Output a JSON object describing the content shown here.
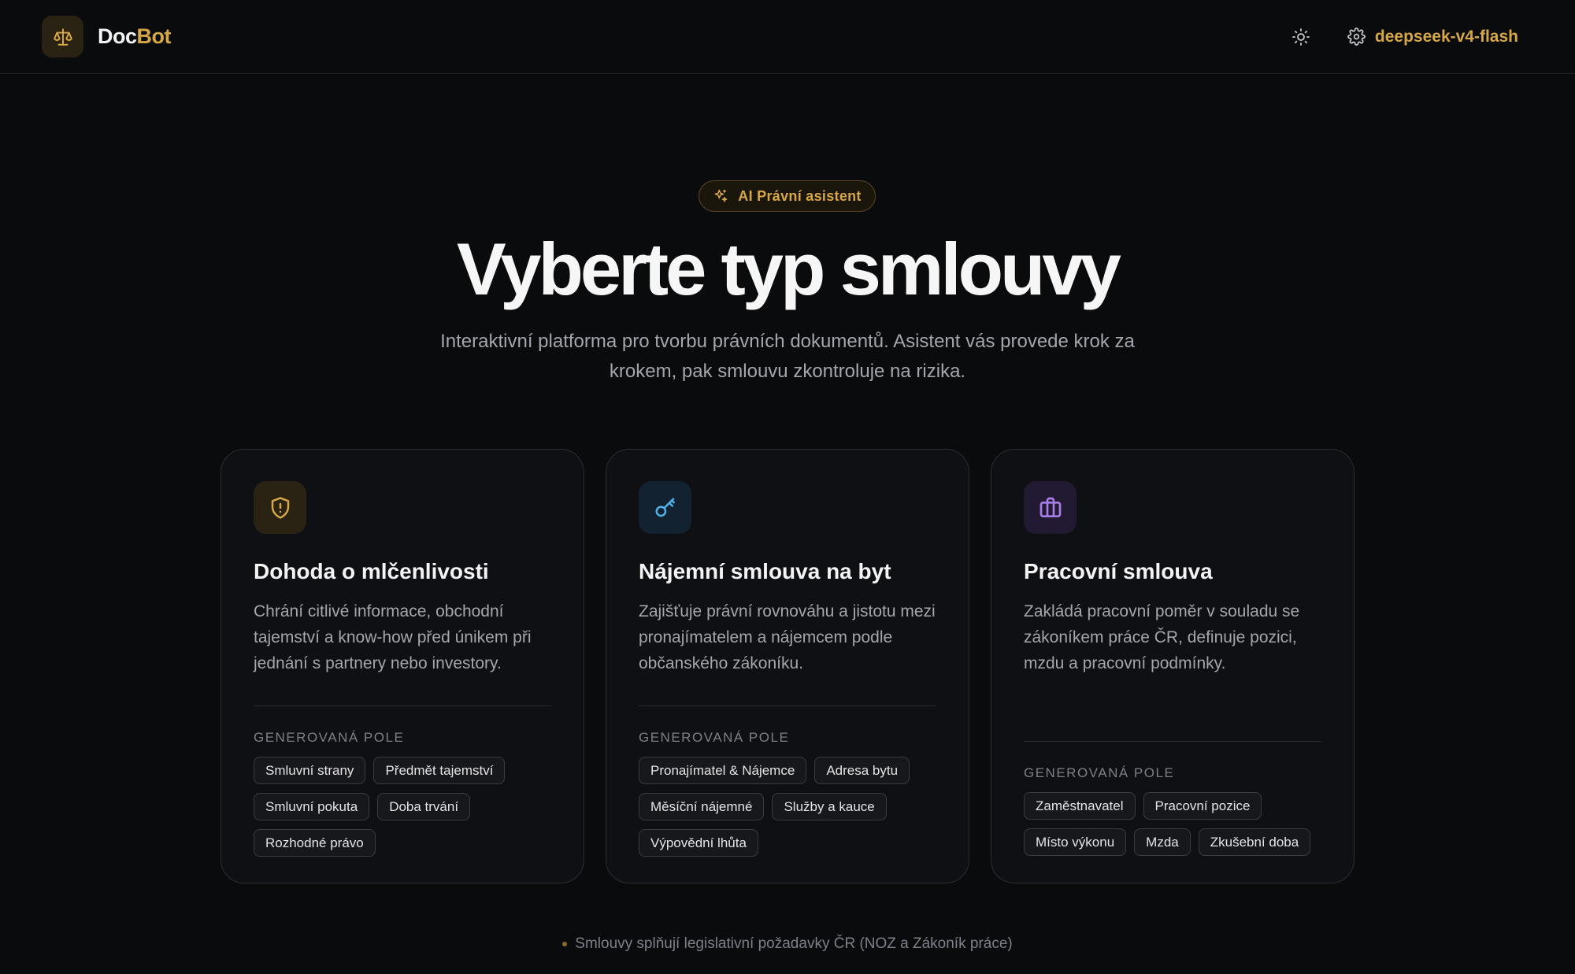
{
  "header": {
    "brand_doc": "Doc",
    "brand_bot": "Bot",
    "model_label": "deepseek-v4-flash"
  },
  "hero": {
    "badge": "AI Právní asistent",
    "title": "Vyberte typ smlouvy",
    "subtitle": "Interaktivní platforma pro tvorbu právních dokumentů. Asistent vás provede krok za krokem, pak smlouvu zkontroluje na rizika."
  },
  "cards": [
    {
      "icon": "shield-alert-icon",
      "accent": "#d6a747",
      "title": "Dohoda o mlčenlivosti",
      "description": "Chrání citlivé informace, obchodní tajemství a know-how před únikem při jednání s partnery nebo investory.",
      "fields_label": "GENEROVANÁ POLE",
      "fields": [
        "Smluvní strany",
        "Předmět tajemství",
        "Smluvní pokuta",
        "Doba trvání",
        "Rozhodné právo"
      ]
    },
    {
      "icon": "key-icon",
      "accent": "#4fb3e8",
      "title": "Nájemní smlouva na byt",
      "description": "Zajišťuje právní rovnováhu a jistotu mezi pronajímatelem a nájemcem podle občanského zákoníku.",
      "fields_label": "GENEROVANÁ POLE",
      "fields": [
        "Pronajímatel & Nájemce",
        "Adresa bytu",
        "Měsíční nájemné",
        "Služby a kauce",
        "Výpovědní lhůta"
      ]
    },
    {
      "icon": "briefcase-icon",
      "accent": "#a67ee8",
      "title": "Pracovní smlouva",
      "description": "Zakládá pracovní poměr v souladu se zákoníkem práce ČR, definuje pozici, mzdu a pracovní podmínky.",
      "fields_label": "GENEROVANÁ POLE",
      "fields": [
        "Zaměstnavatel",
        "Pracovní pozice",
        "Místo výkonu",
        "Mzda",
        "Zkušební doba"
      ]
    }
  ],
  "footer": {
    "note": "Smlouvy splňují legislativní požadavky ČR (NOZ a Zákoník práce)"
  }
}
